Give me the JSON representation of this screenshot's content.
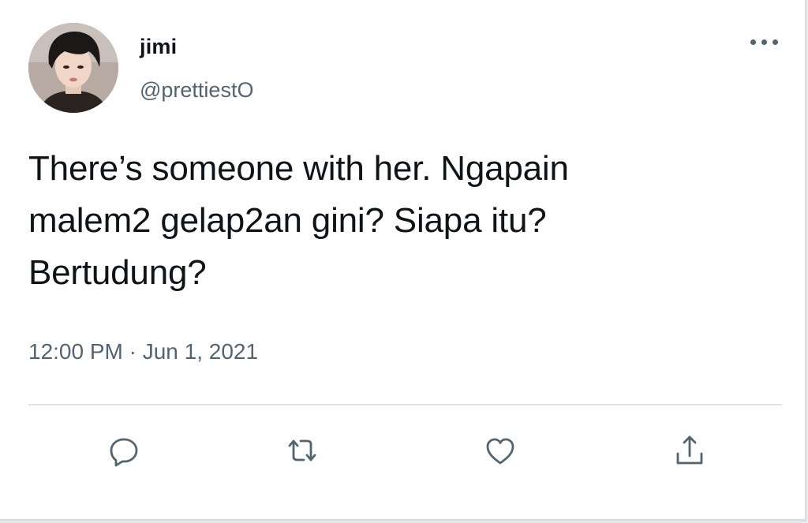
{
  "tweet": {
    "author": {
      "display_name": "jimi",
      "handle": "@prettiestO",
      "avatar_icon": "profile-photo"
    },
    "text_lines": [
      "There’s someone with her. Ngapain",
      "malem2 gelap2an gini? Siapa itu?",
      "Bertudung?"
    ],
    "timestamp": "12:00 PM · Jun 1, 2021",
    "more_icon": "more-horizontal-icon",
    "actions": [
      {
        "icon": "reply-icon"
      },
      {
        "icon": "retweet-icon"
      },
      {
        "icon": "like-icon"
      },
      {
        "icon": "share-icon"
      }
    ]
  },
  "colors": {
    "text_primary": "#0f1419",
    "text_secondary": "#536471",
    "divider": "#dfe3e7",
    "background": "#ffffff"
  }
}
